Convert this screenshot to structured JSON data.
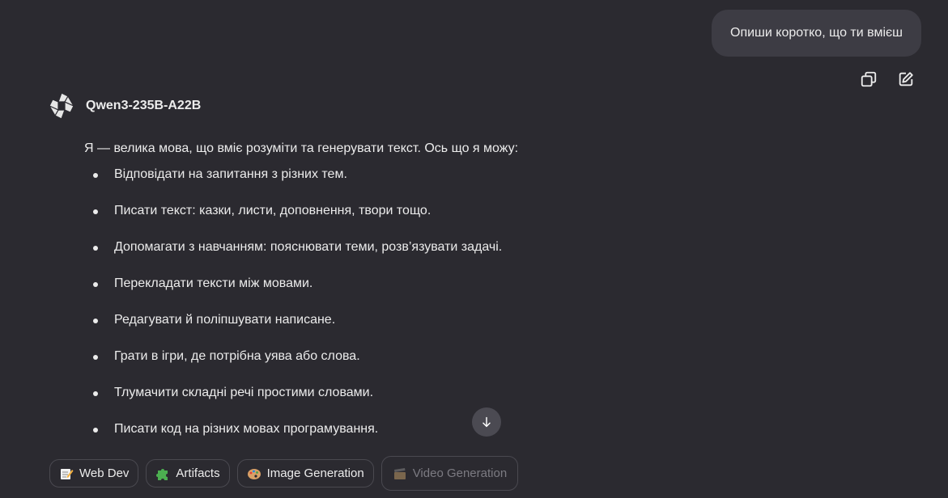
{
  "user_message": {
    "text": "Опиши коротко, що ти вмієш"
  },
  "message_actions": {
    "copy_icon": "copy-icon",
    "edit_icon": "edit-icon"
  },
  "assistant": {
    "model_name": "Qwen3-235B-A22B",
    "intro": "Я — велика мова, що вміє розуміти та генерувати текст. Ось що я можу:",
    "items": [
      "Відповідати на запитання з різних тем.",
      "Писати текст: казки, листи, доповнення, твори тощо.",
      "Допомагати з навчанням: пояснювати теми, розв’язувати задачі.",
      "Перекладати тексти між мовами.",
      "Редагувати й поліпшувати написане.",
      "Грати в ігри, де потрібна уява або слова.",
      "Тлумачити складні речі простими словами.",
      "Писати код на різних мовах програмування."
    ]
  },
  "scroll_button": {
    "icon": "arrow-down-icon"
  },
  "chips": {
    "web_dev": "Web Dev",
    "artifacts": "Artifacts",
    "image_generation": "Image Generation",
    "video_generation": "Video Generation"
  },
  "colors": {
    "background": "#2b2a30",
    "bubble": "#3d3c44",
    "text": "#ececec",
    "muted": "#7c7b82"
  }
}
